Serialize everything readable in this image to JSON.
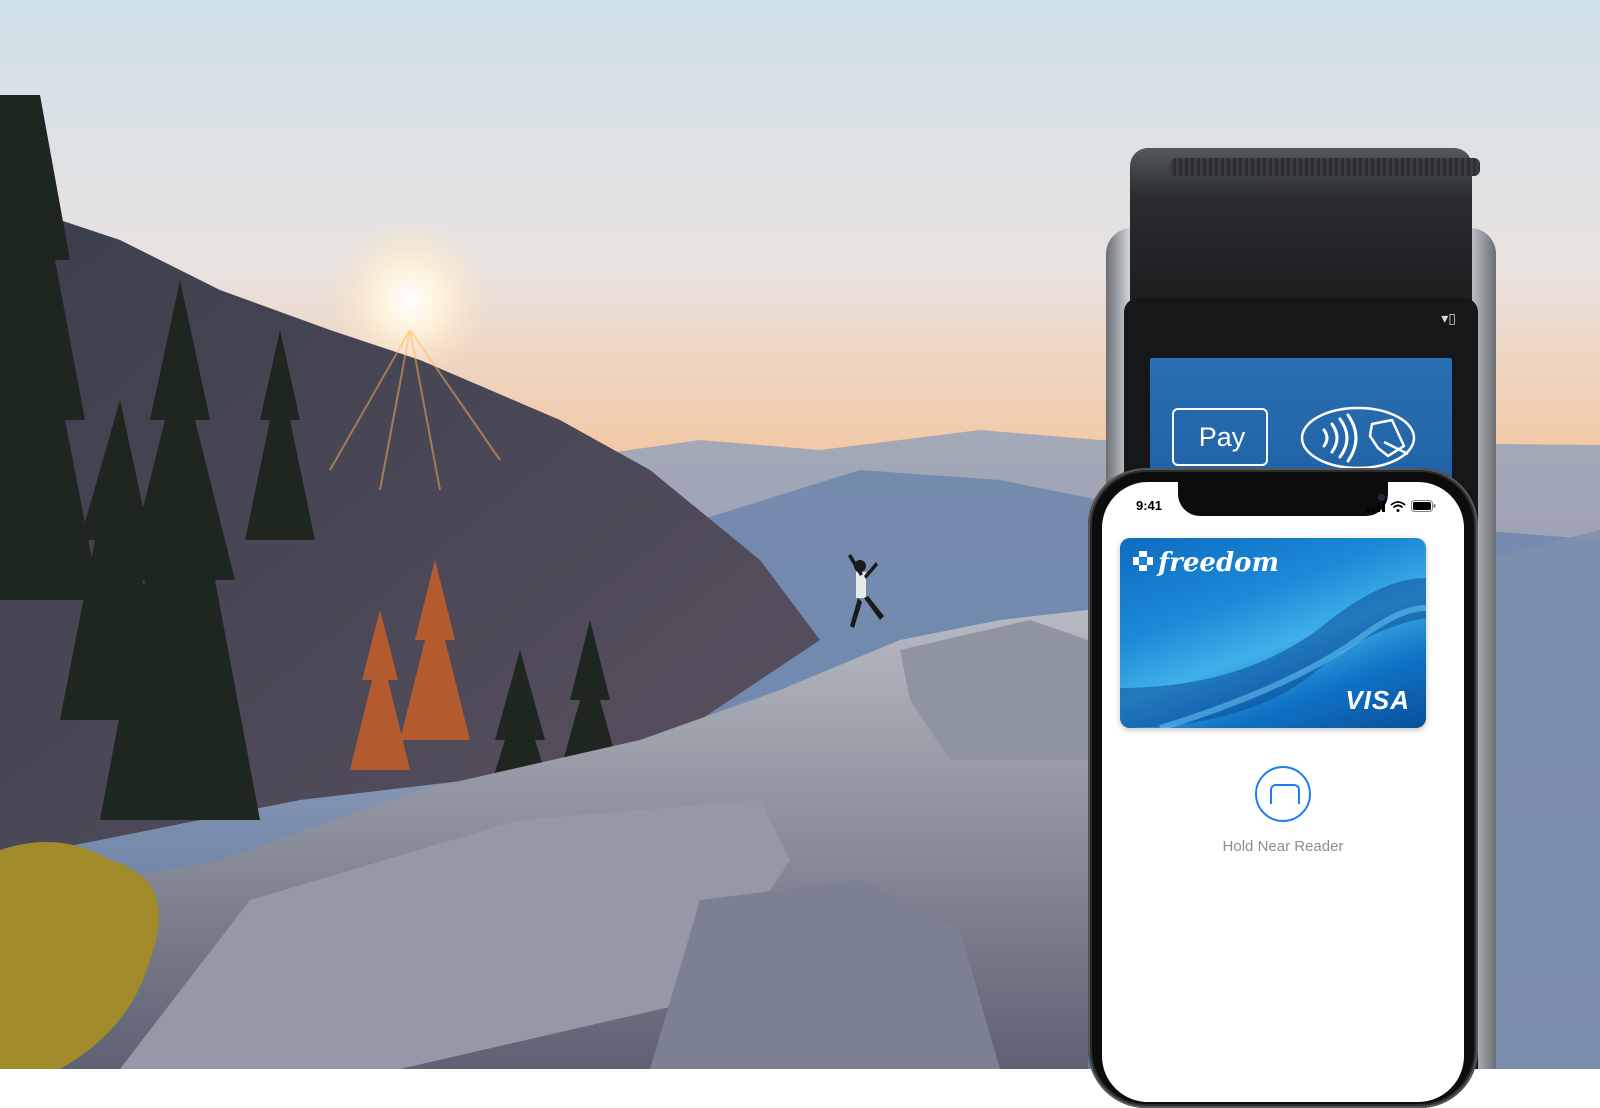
{
  "terminal": {
    "brand_logo": "apple-icon",
    "pay_label": "Pay",
    "contactless_icon": "contactless-icon",
    "chip_icon": "card-slot-icon"
  },
  "phone": {
    "status": {
      "time": "9:41"
    },
    "card": {
      "brand": "freedom",
      "network": "VISA",
      "issuer_logo": "chase-octagon-icon"
    },
    "prompt": "Hold Near Reader"
  },
  "colors": {
    "screen_blue": "#2a6fb3",
    "reader_icon_blue": "#1d7cf2",
    "prompt_gray": "#8e8e93"
  }
}
